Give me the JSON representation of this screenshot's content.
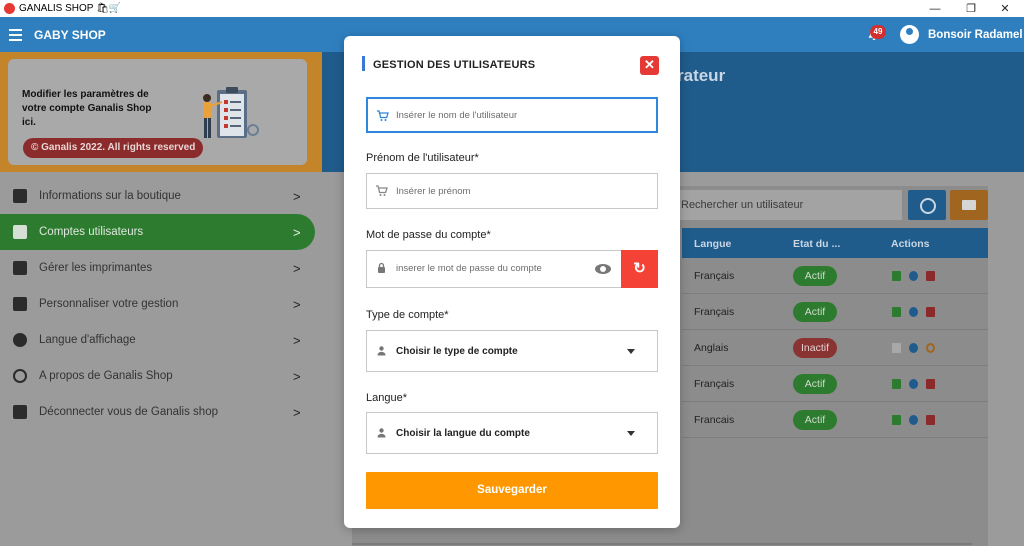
{
  "window": {
    "title": "GANALIS SHOP 🛍🛒",
    "controls": {
      "minimize": "—",
      "maximize": "❐",
      "close": "✕"
    }
  },
  "appbar": {
    "brand": "GABY SHOP",
    "notifications_count": "49",
    "greeting": "Bonsoir Radamel"
  },
  "promo": {
    "text": "Modifier les paramètres de votre compte Ganalis Shop ici.",
    "copyright": "© Ganalis 2022. All rights reserved"
  },
  "sidebar": {
    "items": [
      {
        "label": "Informations sur la boutique",
        "icon": "shopping-bag-icon"
      },
      {
        "label": "Comptes utilisateurs",
        "icon": "users-gear-icon",
        "active": true
      },
      {
        "label": "Gérer les imprimantes",
        "icon": "printer-icon"
      },
      {
        "label": "Personnaliser votre gestion",
        "icon": "dashboard-add-icon"
      },
      {
        "label": "Langue d'affichage",
        "icon": "globe-icon"
      },
      {
        "label": "A propos de Ganalis Shop",
        "icon": "info-icon"
      },
      {
        "label": "Déconnecter vous de Ganalis shop",
        "icon": "logout-lock-icon"
      }
    ],
    "chevron": ">"
  },
  "main": {
    "hero_title_fragment": "rateur",
    "search_placeholder": "Rechercher un utilisateur",
    "table": {
      "headers": {
        "langue": "Langue",
        "etat": "Etat du ...",
        "actions": "Actions"
      },
      "rows": [
        {
          "langue": "Français",
          "etat": "Actif"
        },
        {
          "langue": "Français",
          "etat": "Actif"
        },
        {
          "langue": "Anglais",
          "etat": "Inactif"
        },
        {
          "langue": "Français",
          "etat": "Actif"
        },
        {
          "langue": "Francais",
          "etat": "Actif"
        }
      ]
    }
  },
  "modal": {
    "title": "GESTION DES UTILISATEURS",
    "close": "✕",
    "username_placeholder": "Insérer le nom de l'utilisateur",
    "prenom_label": "Prénom de l'utilisateur*",
    "prenom_placeholder": "Insérer le prénom",
    "password_label": "Mot de passe du compte*",
    "password_placeholder": "inserer le mot de passe du compte",
    "type_label": "Type de compte*",
    "type_value": "Choisir le type de compte",
    "langue_label": "Langue*",
    "langue_value": "Choisir la langue du compte",
    "save_label": "Sauvegarder",
    "refresh_icon": "↻"
  },
  "colors": {
    "appbar": "#2f7fbf",
    "active_item": "#2d7b2f",
    "close_button": "#e53935",
    "save_button": "#ff9800",
    "focus_border": "#2e86de"
  }
}
